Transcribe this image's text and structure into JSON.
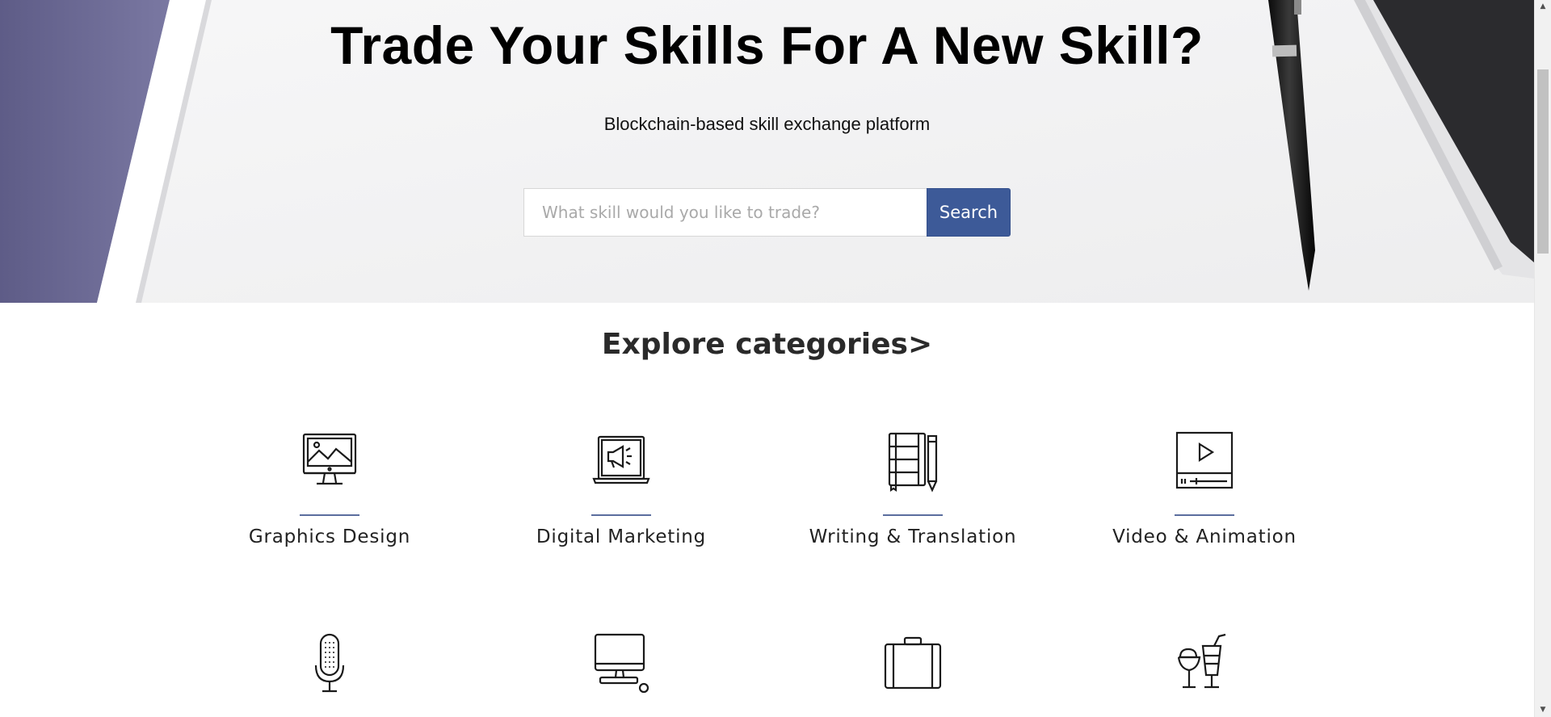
{
  "hero": {
    "title": "Trade Your Skills For A New Skill?",
    "subtitle": "Blockchain-based skill exchange platform",
    "search": {
      "placeholder": "What skill would you like to trade?",
      "value": "",
      "button_label": "Search"
    }
  },
  "categories": {
    "title": "Explore categories>",
    "items": [
      {
        "label": "Graphics Design",
        "icon": "monitor-landscape-icon"
      },
      {
        "label": "Digital Marketing",
        "icon": "laptop-megaphone-icon"
      },
      {
        "label": "Writing & Translation",
        "icon": "notebook-pencil-icon"
      },
      {
        "label": "Video & Animation",
        "icon": "video-player-icon"
      },
      {
        "label": "",
        "icon": "microphone-icon"
      },
      {
        "label": "",
        "icon": "desktop-computer-icon"
      },
      {
        "label": "",
        "icon": "briefcase-icon"
      },
      {
        "label": "",
        "icon": "food-drink-icon"
      }
    ]
  },
  "colors": {
    "accent": "#3d5a98",
    "divider": "#5b6e9e",
    "hero_bg": "#f3f3f4",
    "tablet_purple": "#6b6a94"
  }
}
